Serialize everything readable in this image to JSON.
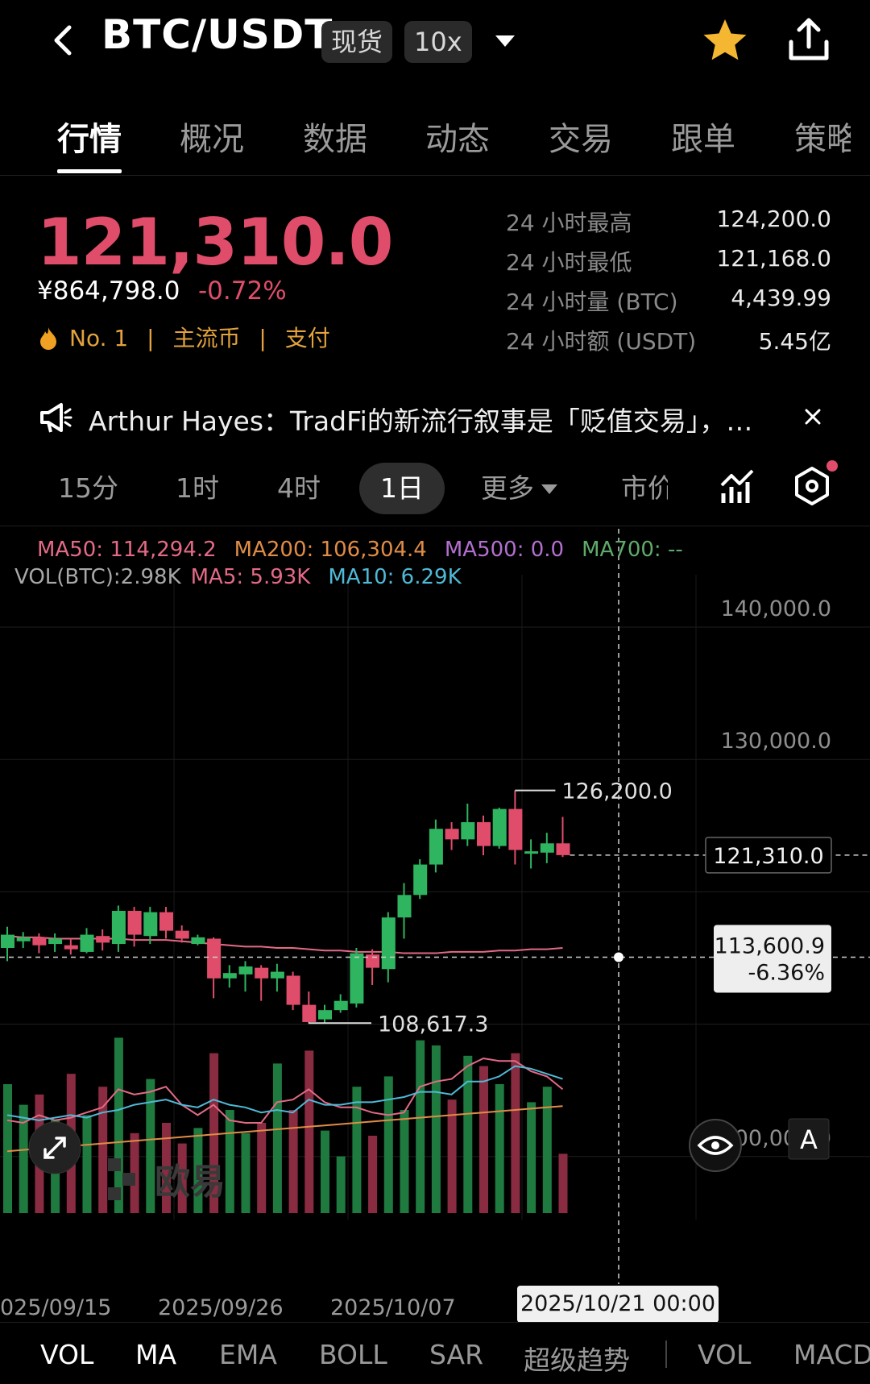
{
  "header": {
    "pair": "BTC/USDT",
    "market_tag": "现货",
    "leverage_tag": "10x"
  },
  "tabs": [
    "行情",
    "概况",
    "数据",
    "动态",
    "交易",
    "跟单",
    "策略"
  ],
  "price": {
    "last": "121,310.0",
    "cny": "¥864,798.0",
    "change": "-0.72%",
    "rank": "No. 1",
    "category": "主流币",
    "usage": "支付"
  },
  "stats": [
    {
      "label": "24 小时最高",
      "value": "124,200.0"
    },
    {
      "label": "24 小时最低",
      "value": "121,168.0"
    },
    {
      "label": "24 小时量 (BTC)",
      "value": "4,439.99"
    },
    {
      "label": "24 小时额 (USDT)",
      "value": "5.45亿"
    }
  ],
  "news": {
    "text": "Arthur Hayes：TradFi的新流行叙事是「贬值交易」，…"
  },
  "timeframes": [
    "15分",
    "1时",
    "4时",
    "1日",
    "更多",
    "市价"
  ],
  "selected_timeframe": "1日",
  "indicators": {
    "ma_line": [
      {
        "text": "MA50: 114,294.2",
        "color": "#e46a86"
      },
      {
        "text": "MA200: 106,304.4",
        "color": "#e08c46"
      },
      {
        "text": "MA500: 0.0",
        "color": "#b36fcf"
      },
      {
        "text": "MA700: --",
        "color": "#5faa6a"
      }
    ],
    "vol_line": [
      {
        "text": "VOL(BTC):2.98K",
        "color": "#a8a8a8"
      },
      {
        "text": "MA5: 5.93K",
        "color": "#e46a86"
      },
      {
        "text": "MA10: 6.29K",
        "color": "#4fb9d6"
      }
    ]
  },
  "chart_data": {
    "type": "candlestick",
    "price_axis_ticks": [
      "140,000.0",
      "130,000.0",
      "100,000.0"
    ],
    "date_labels": [
      "025/09/15",
      "2025/09/26",
      "2025/10/07"
    ],
    "ylim": [
      94000,
      144000
    ],
    "candles": [
      [
        114300,
        115300,
        113300,
        115900
      ],
      [
        114800,
        115100,
        114300,
        115500
      ],
      [
        115100,
        114500,
        113900,
        115400
      ],
      [
        114600,
        115000,
        114000,
        115400
      ],
      [
        114500,
        114200,
        113800,
        115000
      ],
      [
        114000,
        115300,
        113900,
        115800
      ],
      [
        115200,
        114700,
        114100,
        115700
      ],
      [
        114600,
        117100,
        114000,
        117500
      ],
      [
        117100,
        115300,
        114400,
        117400
      ],
      [
        115200,
        117000,
        114600,
        117400
      ],
      [
        117000,
        115600,
        115000,
        117400
      ],
      [
        115600,
        115000,
        114700,
        116000
      ],
      [
        114600,
        115100,
        114500,
        115300
      ],
      [
        115000,
        112000,
        110500,
        115100
      ],
      [
        112000,
        112400,
        111300,
        113000
      ],
      [
        112300,
        112900,
        111000,
        113300
      ],
      [
        112800,
        112000,
        110300,
        113000
      ],
      [
        112000,
        112500,
        111000,
        113100
      ],
      [
        112200,
        110000,
        109600,
        112500
      ],
      [
        110000,
        108700,
        108600,
        111000
      ],
      [
        108900,
        109600,
        108617,
        110000
      ],
      [
        109600,
        110300,
        109400,
        110800
      ],
      [
        110100,
        113900,
        109800,
        114300
      ],
      [
        113800,
        112800,
        111500,
        114200
      ],
      [
        112700,
        116600,
        111700,
        117000
      ],
      [
        116600,
        118300,
        115000,
        119200
      ],
      [
        118300,
        120600,
        118000,
        121000
      ],
      [
        120600,
        123300,
        120000,
        124000
      ],
      [
        123300,
        122500,
        121700,
        123800
      ],
      [
        122500,
        123800,
        122000,
        125200
      ],
      [
        123800,
        122000,
        121300,
        124300
      ],
      [
        122000,
        124800,
        121800,
        124900
      ],
      [
        124800,
        121700,
        120600,
        126200
      ],
      [
        121500,
        121600,
        120300,
        122500
      ],
      [
        121500,
        122200,
        120700,
        123000
      ],
      [
        122200,
        121310,
        121168,
        124200
      ]
    ],
    "high_marker": "126,200.0",
    "low_marker": "108,617.3",
    "ma50": [
      115200,
      115100,
      115100,
      115000,
      115000,
      115000,
      115000,
      115000,
      114900,
      114900,
      114900,
      114800,
      114700,
      114600,
      114500,
      114400,
      114400,
      114300,
      114300,
      114200,
      114100,
      114100,
      114000,
      114000,
      114000,
      113900,
      113900,
      113900,
      114000,
      114000,
      114000,
      114100,
      114100,
      114200,
      114200,
      114300
    ],
    "volume": [
      5.0,
      4.2,
      4.6,
      3.6,
      5.4,
      3.8,
      4.9,
      6.8,
      3.1,
      5.2,
      3.5,
      2.7,
      3.3,
      6.2,
      4.0,
      3.1,
      3.5,
      5.8,
      4.0,
      6.3,
      3.2,
      2.2,
      4.9,
      3.0,
      5.3,
      4.0,
      6.7,
      6.5,
      4.4,
      6.1,
      5.7,
      5.0,
      6.2,
      4.3,
      4.9,
      2.3
    ],
    "vol_ma5": [
      3.6,
      3.5,
      3.8,
      3.6,
      3.7,
      3.9,
      4.1,
      4.8,
      4.6,
      4.7,
      4.9,
      4.2,
      3.8,
      4.2,
      3.6,
      3.5,
      3.5,
      4.3,
      4.4,
      4.8,
      4.3,
      4.1,
      4.1,
      3.9,
      3.8,
      3.9,
      4.9,
      5.1,
      5.2,
      5.7,
      6.0,
      5.9,
      5.9,
      5.5,
      5.3,
      4.8
    ],
    "vol_ma10": [
      3.8,
      3.7,
      3.6,
      3.7,
      3.8,
      3.7,
      3.9,
      4.0,
      4.2,
      4.3,
      4.4,
      4.2,
      4.1,
      4.4,
      4.2,
      4.1,
      3.9,
      4.0,
      3.9,
      4.4,
      4.2,
      4.2,
      4.3,
      4.3,
      4.4,
      4.5,
      4.7,
      4.7,
      4.6,
      5.1,
      5.1,
      5.3,
      5.7,
      5.6,
      5.4,
      5.2
    ],
    "vol_ma_long": [
      2.4,
      2.45,
      2.5,
      2.55,
      2.6,
      2.65,
      2.7,
      2.75,
      2.8,
      2.85,
      2.9,
      2.95,
      3.0,
      3.05,
      3.1,
      3.15,
      3.2,
      3.25,
      3.3,
      3.35,
      3.4,
      3.45,
      3.5,
      3.55,
      3.6,
      3.65,
      3.7,
      3.75,
      3.8,
      3.85,
      3.9,
      3.95,
      4.0,
      4.05,
      4.1,
      4.15
    ],
    "last_price_label": "121,310.0",
    "crosshair": {
      "price": "113,600.9",
      "pct": "-6.36%",
      "date": "2025/10/21 00:00"
    }
  },
  "watermark": "欧易",
  "bottom_tabs": [
    "VOL",
    "MA",
    "EMA",
    "BOLL",
    "SAR",
    "超级趋势",
    "VOL",
    "MACD"
  ],
  "colors": {
    "up": "#2fb560",
    "down": "#e04d6a",
    "accent": "#f5b731"
  }
}
